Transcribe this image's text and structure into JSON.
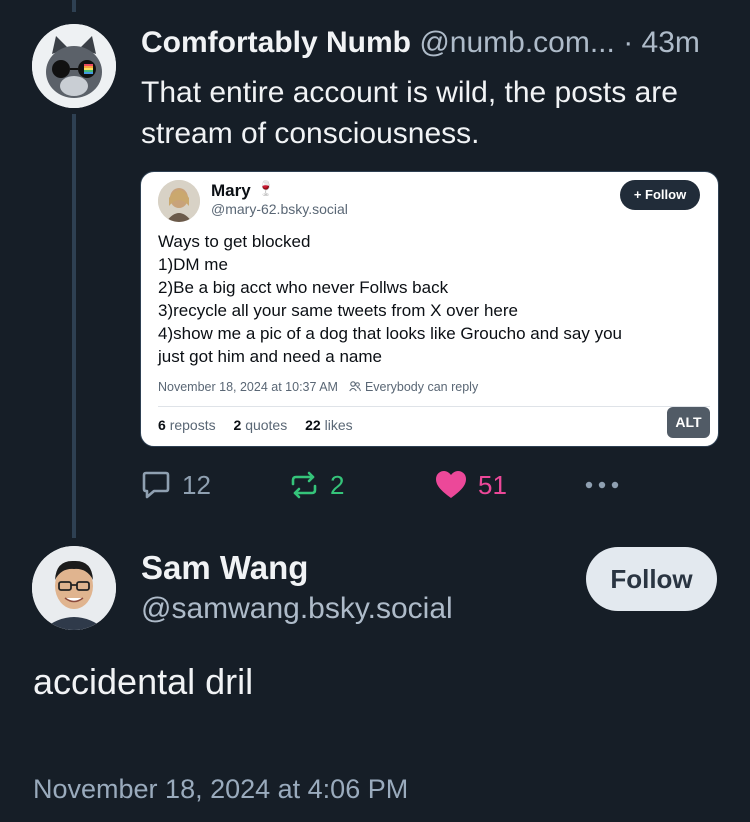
{
  "colors": {
    "background": "#161e27",
    "thread_line": "#2e4052",
    "repost": "#35c47a",
    "like": "#ec4899",
    "muted": "#8fa0b1"
  },
  "reply_post": {
    "author_name": "Comfortably Numb",
    "author_handle": "@numb.com...",
    "time_sep": " · ",
    "time": "43m",
    "text": "That entire account is wild, the posts are stream of consciousness.",
    "embed": {
      "name": "Mary",
      "name_emoji": "🍷",
      "handle": "@mary-62.bsky.social",
      "follow_label": "+ Follow",
      "lines": [
        "Ways to get blocked",
        "1)DM me",
        "2)Be a big acct who never Follws back",
        "3)recycle all your same tweets from X over here",
        "4)show me a pic of a dog that looks like Groucho and say you",
        "just got him and need a name"
      ],
      "timestamp": "November 18, 2024 at 10:37 AM",
      "reply_setting": "Everybody can reply",
      "reposts_count": "6",
      "reposts_label": "reposts",
      "quotes_count": "2",
      "quotes_label": "quotes",
      "likes_count": "22",
      "likes_label": "likes"
    },
    "alt_label": "ALT",
    "actions": {
      "reply_count": "12",
      "repost_count": "2",
      "like_count": "51"
    }
  },
  "main_post": {
    "author_name": "Sam Wang",
    "author_handle": "@samwang.bsky.social",
    "follow_label": "Follow",
    "text": "accidental dril",
    "timestamp": "November 18, 2024 at 4:06 PM"
  }
}
